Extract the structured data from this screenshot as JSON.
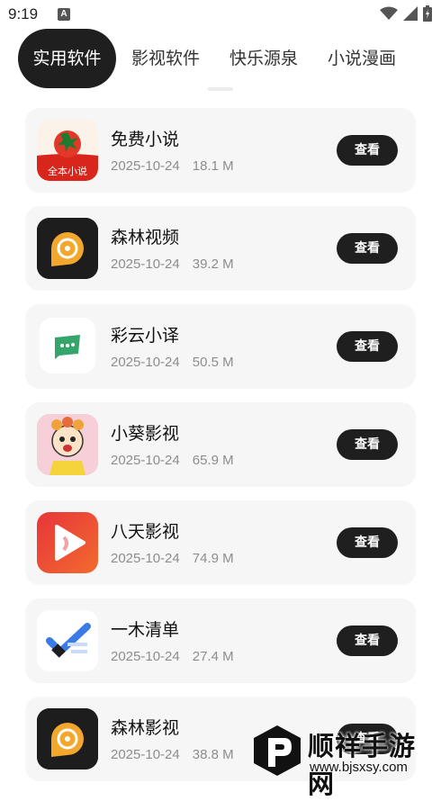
{
  "status_bar": {
    "time": "9:19",
    "notif_letter": "A"
  },
  "tabs": [
    {
      "label": "实用软件",
      "active": true
    },
    {
      "label": "影视软件"
    },
    {
      "label": "快乐源泉"
    },
    {
      "label": "小说漫画"
    }
  ],
  "apps": [
    {
      "name": "免费小说",
      "date": "2025-10-24",
      "size": "18.1 M",
      "button": "查看",
      "icon": "tomato-novel-icon",
      "icon_text": "全本小说"
    },
    {
      "name": "森林视频",
      "date": "2025-10-24",
      "size": "39.2 M",
      "button": "查看",
      "icon": "forest-video-icon"
    },
    {
      "name": "彩云小译",
      "date": "2025-10-24",
      "size": "50.5 M",
      "button": "查看",
      "icon": "caiyun-translate-icon"
    },
    {
      "name": "小葵影视",
      "date": "2025-10-24",
      "size": "65.9 M",
      "button": "查看",
      "icon": "cartoon-kid-icon"
    },
    {
      "name": "八天影视",
      "date": "2025-10-24",
      "size": "74.9 M",
      "button": "查看",
      "icon": "play-icon"
    },
    {
      "name": "一木清单",
      "date": "2025-10-24",
      "size": "27.4 M",
      "button": "查看",
      "icon": "checkmark-icon"
    },
    {
      "name": "森林影视",
      "date": "2025-10-24",
      "size": "38.8 M",
      "button": "查看",
      "icon": "forest-video-icon"
    }
  ],
  "watermark": {
    "title": "顺祥手游网",
    "url": "www.bjsxsy.com"
  },
  "colors": {
    "accent": "#1f1f1f",
    "card_bg": "#f6f6f6",
    "meta": "#8d8d8d"
  }
}
